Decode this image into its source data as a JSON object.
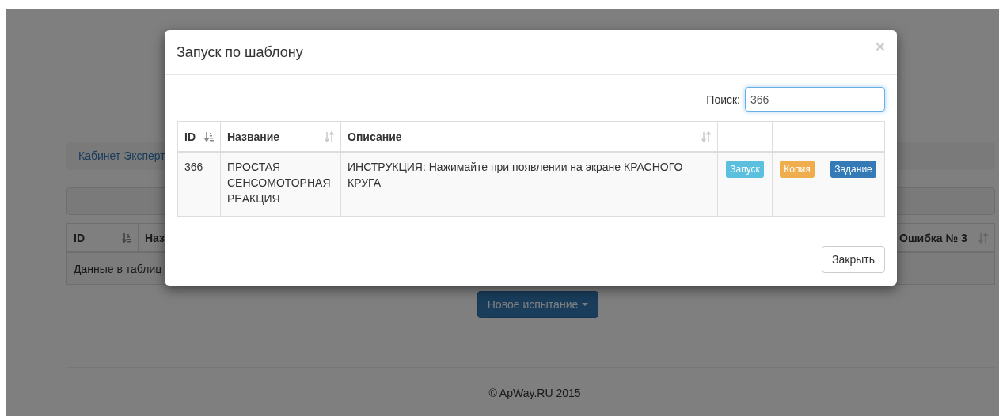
{
  "page": {
    "breadcrumb": "Кабинет Эксперт",
    "table": {
      "columns": [
        {
          "label": "ID",
          "sorted": true
        },
        {
          "label": "Наз"
        },
        {
          "label": "Ошибка № 3",
          "sorted": false
        }
      ],
      "rows": [
        {
          "cells": [
            "Данные в таблиц"
          ]
        }
      ]
    },
    "new_button": {
      "label": "Новое испытание"
    },
    "footer": "© ApWay.RU 2015"
  },
  "modal": {
    "title": "Запуск по шаблону",
    "close_icon": "×",
    "search": {
      "label": "Поиск:",
      "value": "366"
    },
    "table": {
      "columns": [
        {
          "label": "ID",
          "sorted": true
        },
        {
          "label": "Название",
          "sorted": false
        },
        {
          "label": "Описание",
          "sorted": false
        },
        {},
        {},
        {}
      ],
      "rows": [
        {
          "id": "366",
          "name": "ПРОСТАЯ СЕНСОМОТОРНАЯ РЕАКЦИЯ",
          "description": "ИНСТРУКЦИЯ: Нажимайте при появлении на экране КРАСНОГО КРУГА",
          "actions": [
            {
              "label": "Запуск",
              "kind": "info"
            },
            {
              "label": "Копия",
              "kind": "warning"
            },
            {
              "label": "Задание",
              "kind": "primary"
            }
          ]
        }
      ]
    },
    "close_button": "Закрыть"
  }
}
